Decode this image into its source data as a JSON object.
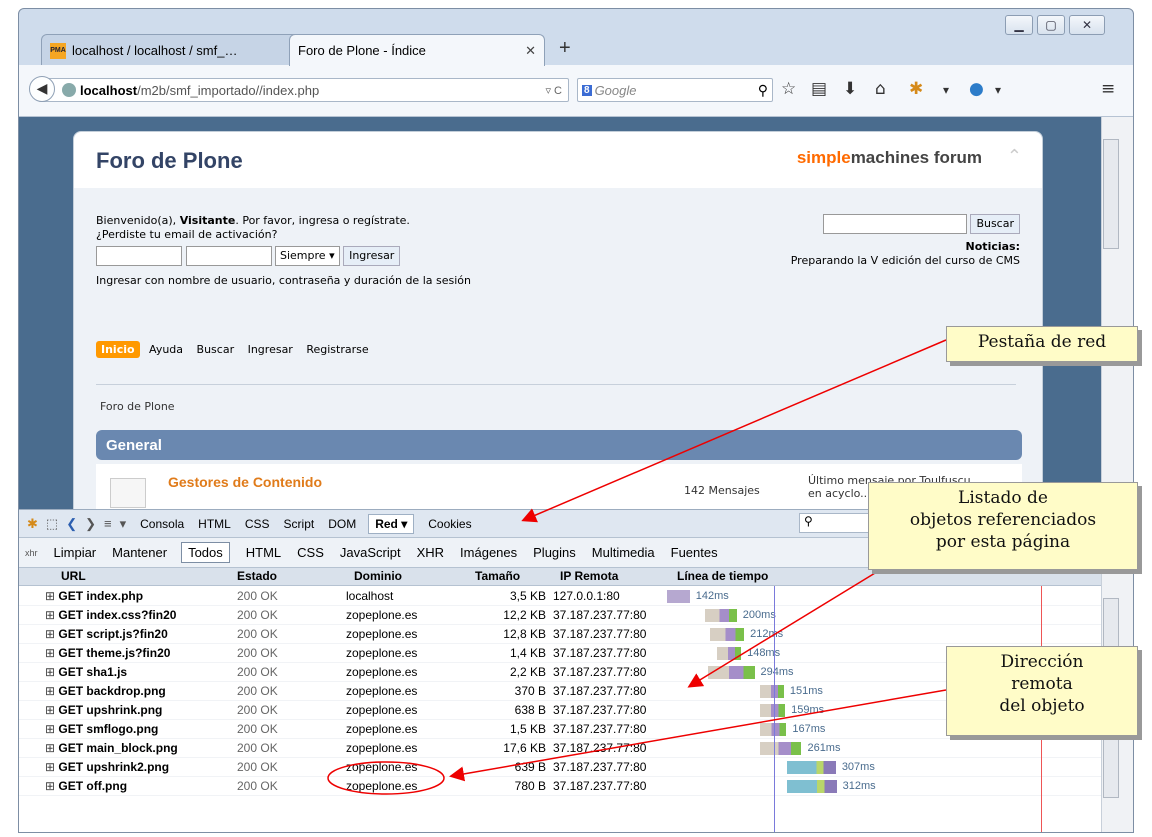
{
  "browser": {
    "tabs": [
      {
        "label": "localhost / localhost / smf_…",
        "favicon": "PMA"
      },
      {
        "label": "Foro de Plone - Índice"
      }
    ],
    "url_host": "localhost",
    "url_path": "/m2b/smf_importado//index.php",
    "search_placeholder": "Google"
  },
  "forum": {
    "title": "Foro de Plone",
    "logo_orange": "simple",
    "logo_rest": "machines forum",
    "welcome_pre": "Bienvenido(a), ",
    "welcome_user": "Visitante",
    "welcome_post": ". Por favor, ingresa o regístrate.",
    "lost_email": "¿Perdiste tu email de activación?",
    "session_select": "Siempre",
    "login_button": "Ingresar",
    "login_hint": "Ingresar con nombre de usuario, contraseña y duración de la sesión",
    "search_button": "Buscar",
    "news_label": "Noticias:",
    "news_text": "Preparando la V edición del curso de CMS",
    "menu": [
      "Inicio",
      "Ayuda",
      "Buscar",
      "Ingresar",
      "Registrarse"
    ],
    "breadcrumb": "Foro de Plone",
    "category": "General",
    "board_name": "Gestores de Contenido",
    "board_messages": "142 Mensajes",
    "last_post": "Último mensaje por Toulfuscu",
    "last_post_in": "en acyclo..."
  },
  "devtools": {
    "panel_tabs": [
      "Consola",
      "HTML",
      "CSS",
      "Script",
      "DOM",
      "Red ▾",
      "Cookies"
    ],
    "active_tab": "Red ▾",
    "filters": [
      "Limpiar",
      "Mantener",
      "Todos",
      "HTML",
      "CSS",
      "JavaScript",
      "XHR",
      "Imágenes",
      "Plugins",
      "Multimedia",
      "Fuentes"
    ],
    "xhr_icon_label": "xhr",
    "columns": [
      "URL",
      "Estado",
      "Dominio",
      "Tamaño",
      "IP Remota",
      "Línea de tiempo"
    ],
    "rows": [
      {
        "url": "GET index.php",
        "status": "200 OK",
        "domain": "localhost",
        "size": "3,5 KB",
        "ip": "127.0.0.1:80",
        "time": "142ms"
      },
      {
        "url": "GET index.css?fin20",
        "status": "200 OK",
        "domain": "zopeplone.es",
        "size": "12,2 KB",
        "ip": "37.187.237.77:80",
        "time": "200ms"
      },
      {
        "url": "GET script.js?fin20",
        "status": "200 OK",
        "domain": "zopeplone.es",
        "size": "12,8 KB",
        "ip": "37.187.237.77:80",
        "time": "212ms"
      },
      {
        "url": "GET theme.js?fin20",
        "status": "200 OK",
        "domain": "zopeplone.es",
        "size": "1,4 KB",
        "ip": "37.187.237.77:80",
        "time": "148ms"
      },
      {
        "url": "GET sha1.js",
        "status": "200 OK",
        "domain": "zopeplone.es",
        "size": "2,2 KB",
        "ip": "37.187.237.77:80",
        "time": "294ms"
      },
      {
        "url": "GET backdrop.png",
        "status": "200 OK",
        "domain": "zopeplone.es",
        "size": "370 B",
        "ip": "37.187.237.77:80",
        "time": "151ms"
      },
      {
        "url": "GET upshrink.png",
        "status": "200 OK",
        "domain": "zopeplone.es",
        "size": "638 B",
        "ip": "37.187.237.77:80",
        "time": "159ms"
      },
      {
        "url": "GET smflogo.png",
        "status": "200 OK",
        "domain": "zopeplone.es",
        "size": "1,5 KB",
        "ip": "37.187.237.77:80",
        "time": "167ms"
      },
      {
        "url": "GET main_block.png",
        "status": "200 OK",
        "domain": "zopeplone.es",
        "size": "17,6 KB",
        "ip": "37.187.237.77:80",
        "time": "261ms"
      },
      {
        "url": "GET upshrink2.png",
        "status": "200 OK",
        "domain": "zopeplone.es",
        "size": "639 B",
        "ip": "37.187.237.77:80",
        "time": "307ms"
      },
      {
        "url": "GET off.png",
        "status": "200 OK",
        "domain": "zopeplone.es",
        "size": "780 B",
        "ip": "37.187.237.77:80",
        "time": "312ms"
      }
    ]
  },
  "annotations": {
    "callout1": "Pestaña de red",
    "callout2_l1": "Listado de",
    "callout2_l2": "objetos referenciados",
    "callout2_l3": "por esta página",
    "callout3_l1": "Dirección",
    "callout3_l2": "remota",
    "callout3_l3": "del objeto"
  }
}
